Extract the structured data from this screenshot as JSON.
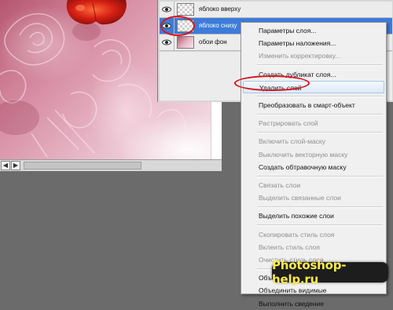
{
  "layers_panel": {
    "layers": [
      {
        "name": "яблоко вверху",
        "thumbnail": "transparent-with-apple",
        "visible": true,
        "selected": false
      },
      {
        "name": "яблоко снизу",
        "thumbnail": "transparent-with-apple",
        "visible": true,
        "selected": true
      },
      {
        "name": "обои фон",
        "thumbnail": "pink-rose-wallpaper",
        "visible": true,
        "selected": false
      }
    ]
  },
  "context_menu": {
    "items": [
      {
        "label": "Параметры слоя...",
        "enabled": true
      },
      {
        "label": "Параметры наложения...",
        "enabled": true
      },
      {
        "label": "Изменить корректировку...",
        "enabled": false
      },
      {
        "separator": true
      },
      {
        "label": "Создать дубликат слоя...",
        "enabled": true
      },
      {
        "label": "Удалить слой",
        "enabled": true,
        "hovered": true,
        "annotated": true
      },
      {
        "separator": true
      },
      {
        "label": "Преобразовать в смарт-объект",
        "enabled": true
      },
      {
        "separator": true
      },
      {
        "label": "Растрировать слой",
        "enabled": false
      },
      {
        "separator": true
      },
      {
        "label": "Включить слой-маску",
        "enabled": false
      },
      {
        "label": "Выключить векторную маску",
        "enabled": false
      },
      {
        "label": "Создать обтравочную маску",
        "enabled": true
      },
      {
        "separator": true
      },
      {
        "label": "Связать слои",
        "enabled": false
      },
      {
        "label": "Выделить связанные слои",
        "enabled": false
      },
      {
        "separator": true
      },
      {
        "label": "Выделить похожие слои",
        "enabled": true
      },
      {
        "separator": true
      },
      {
        "label": "Скопировать стиль слоя",
        "enabled": false
      },
      {
        "label": "Вклеить стиль слоя",
        "enabled": false
      },
      {
        "label": "Очистить стиль слоя",
        "enabled": false
      },
      {
        "separator": true
      },
      {
        "label": "Объединить с предыдущим",
        "enabled": true
      },
      {
        "label": "Объединить видимые",
        "enabled": true
      },
      {
        "label": "Выполнить сведение",
        "enabled": true
      }
    ]
  },
  "watermark": {
    "text": "Photoshop-help.ru"
  },
  "colors": {
    "workspace": "#6b6b6b",
    "selection": "#3d7bd9",
    "annotation": "#d8141e",
    "watermark_text": "#ffe94a"
  },
  "icons": {
    "visibility": "eye-icon",
    "scroll_left": "triangle-left-icon",
    "scroll_right": "triangle-right-icon"
  }
}
